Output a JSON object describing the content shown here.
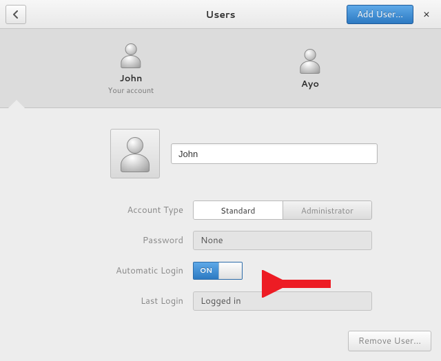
{
  "header": {
    "title": "Users",
    "add_user_label": "Add User...",
    "close_symbol": "×"
  },
  "users": [
    {
      "name": "John",
      "subtitle": "Your account",
      "selected": true
    },
    {
      "name": "Ayo",
      "subtitle": "",
      "selected": false
    }
  ],
  "detail": {
    "name_value": "John",
    "account_type": {
      "label": "Account Type",
      "options": [
        "Standard",
        "Administrator"
      ],
      "selected": "Standard"
    },
    "password": {
      "label": "Password",
      "value": "None"
    },
    "automatic_login": {
      "label": "Automatic Login",
      "on_text": "ON",
      "state": true
    },
    "last_login": {
      "label": "Last Login",
      "value": "Logged in"
    }
  },
  "footer": {
    "remove_user_label": "Remove User..."
  },
  "colors": {
    "accent": "#3d86c6",
    "arrow": "#ed1c24"
  }
}
